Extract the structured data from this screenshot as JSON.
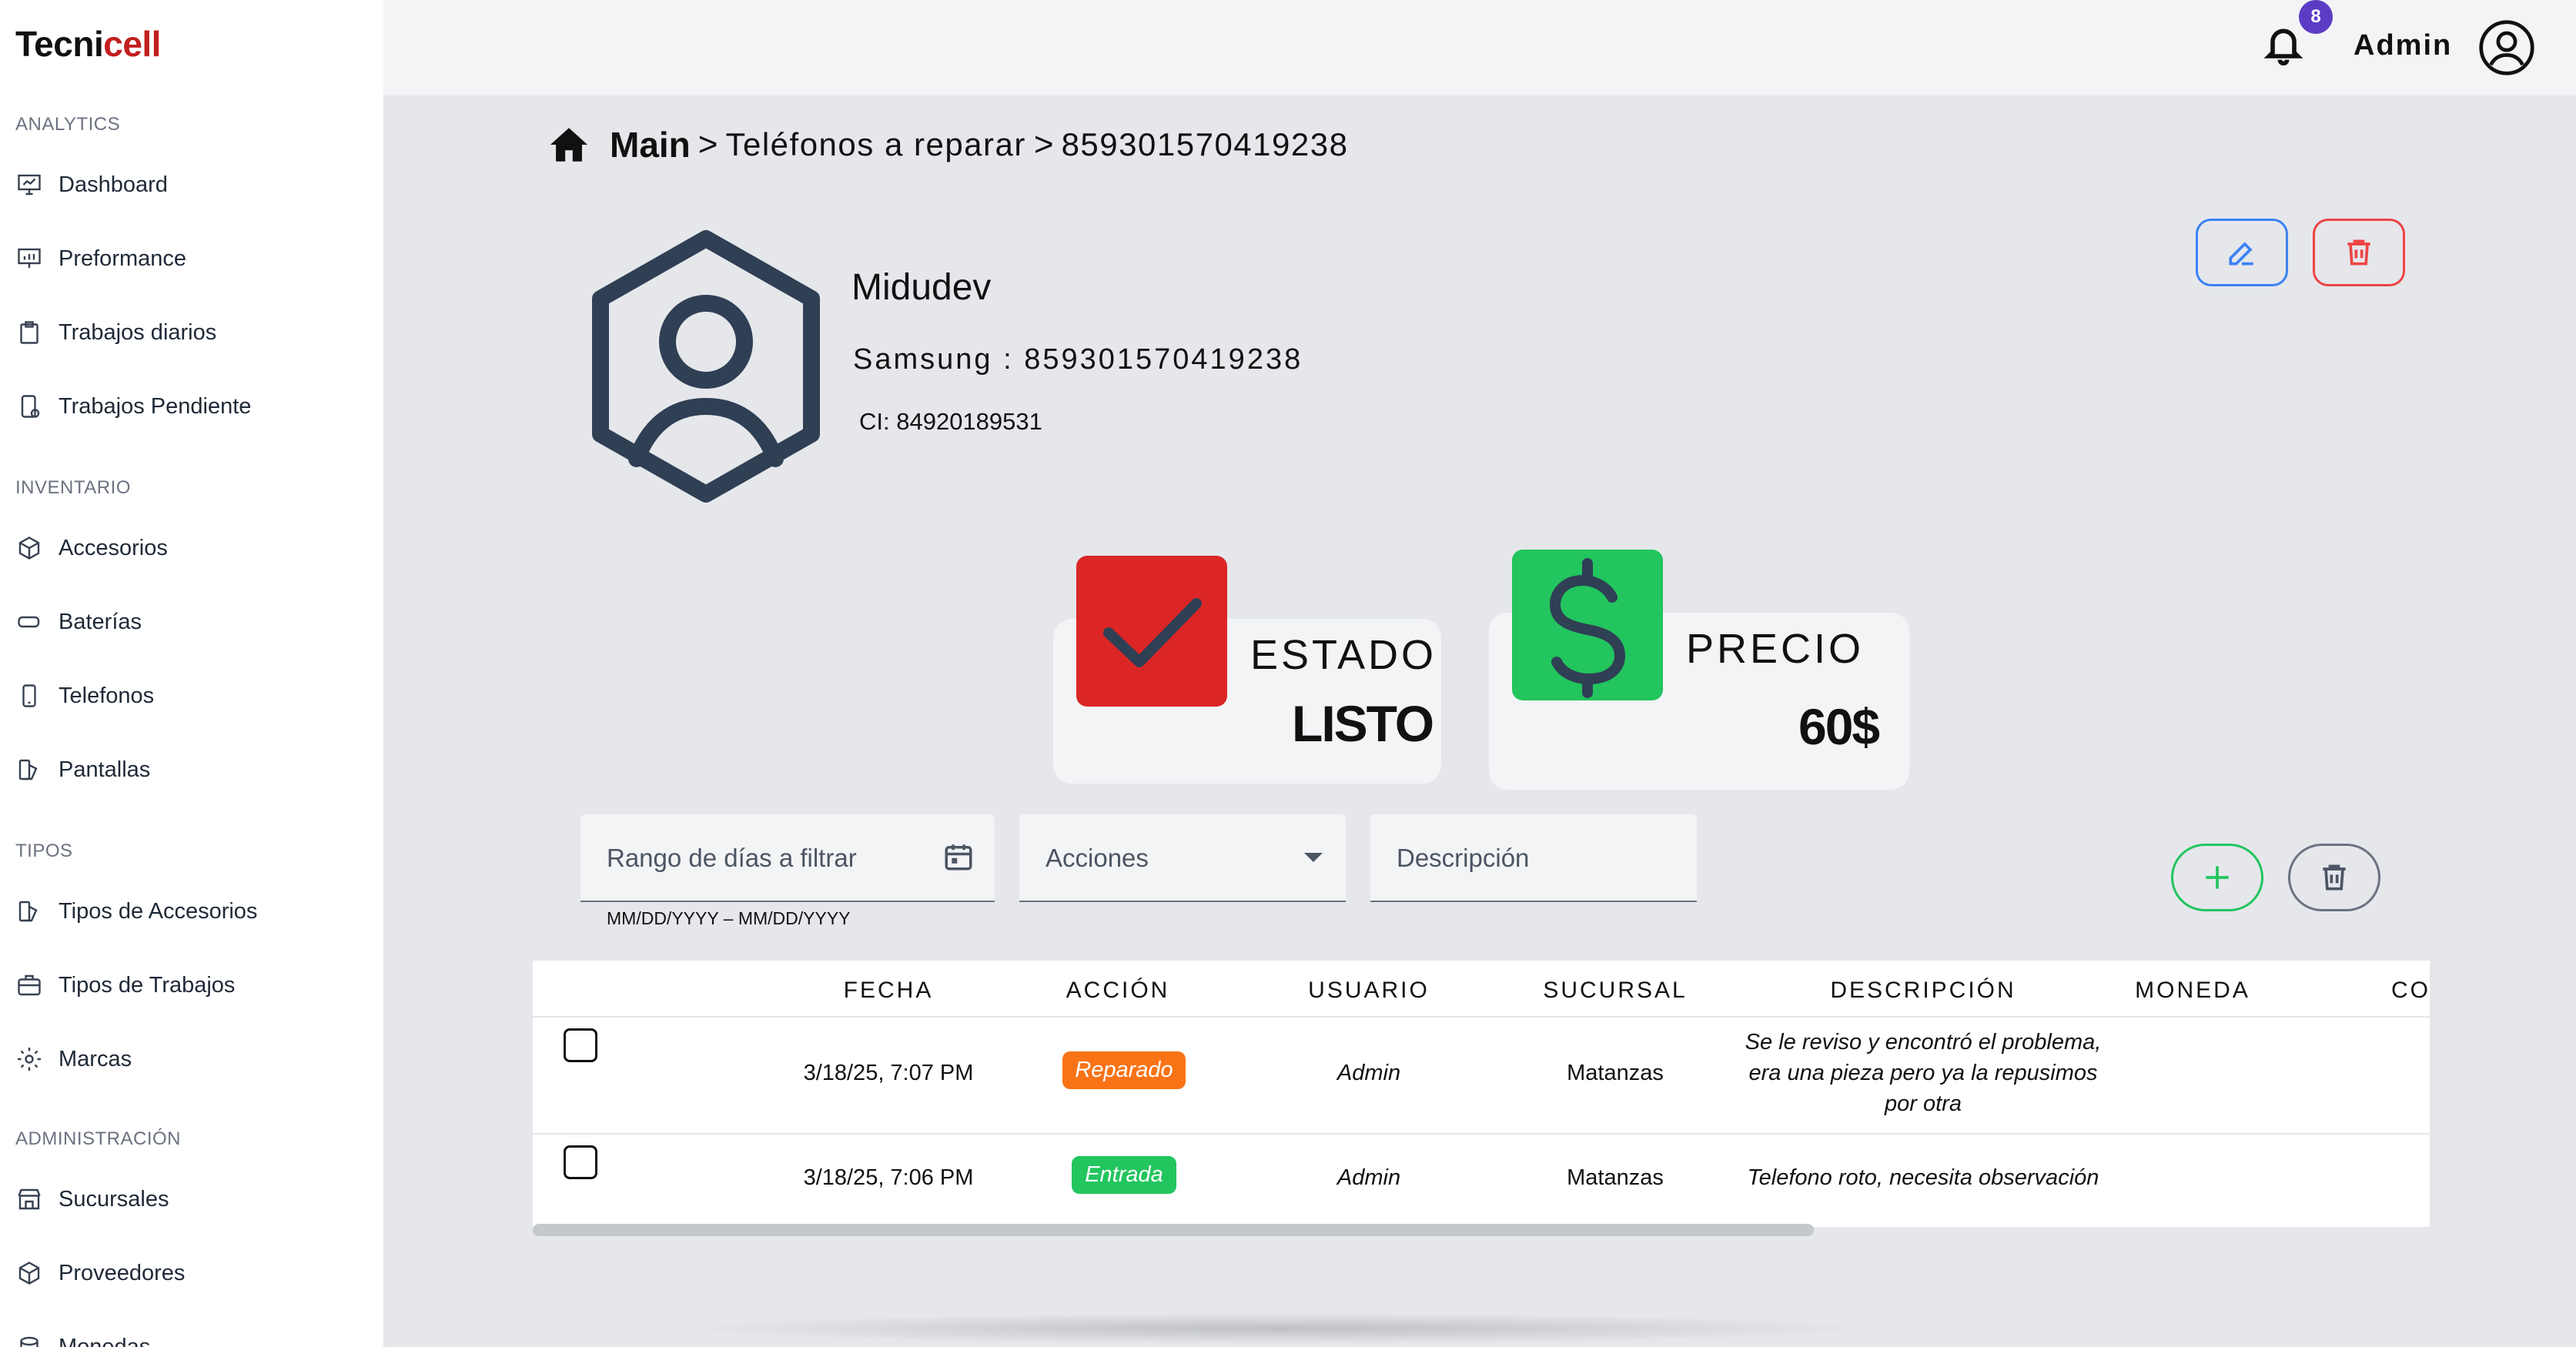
{
  "brand": {
    "part1": "Tecni",
    "part2": "cell"
  },
  "sidebar": {
    "sections": [
      {
        "title": "ANALYTICS",
        "items": [
          "Dashboard",
          "Preformance",
          "Trabajos diarios",
          "Trabajos Pendiente"
        ]
      },
      {
        "title": "INVENTARIO",
        "items": [
          "Accesorios",
          "Baterías",
          "Telefonos",
          "Pantallas"
        ]
      },
      {
        "title": "TIPOS",
        "items": [
          "Tipos de Accesorios",
          "Tipos de Trabajos",
          "Marcas"
        ]
      },
      {
        "title": "ADMINISTRACIÓN",
        "items": [
          "Sucursales",
          "Proveedores",
          "Monedas"
        ]
      }
    ]
  },
  "topbar": {
    "notifications_count": "8",
    "user_label": "Admin"
  },
  "breadcrumb": {
    "main": "Main",
    "sep1": ">",
    "item1": "Teléfonos a reparar",
    "sep2": ">",
    "item2": "859301570419238"
  },
  "client": {
    "name": "Midudev",
    "device": "Samsung : 859301570419238",
    "ci": "CI: 84920189531"
  },
  "estado_card": {
    "label": "ESTADO",
    "value": "LISTO"
  },
  "precio_card": {
    "label": "PRECIO",
    "value": "60$"
  },
  "filters": {
    "date_range": "Rango de días a filtrar",
    "date_helper": "MM/DD/YYYY – MM/DD/YYYY",
    "acciones": "Acciones",
    "descripcion": "Descripción"
  },
  "table": {
    "headers": [
      "FECHA",
      "ACCIÓN",
      "USUARIO",
      "SUCURSAL",
      "DESCRIPCIÓN",
      "MONEDA",
      "CO"
    ],
    "rows": [
      {
        "fecha": "3/18/25, 7:07 PM",
        "accion": "Reparado",
        "usuario": "Admin",
        "sucursal": "Matanzas",
        "descripcion_l1": "Se le reviso y encontró el problema,",
        "descripcion_l2": "era una pieza pero ya la repusimos",
        "descripcion_l3": "por otra"
      },
      {
        "fecha": "3/18/25, 7:06 PM",
        "accion": "Entrada",
        "usuario": "Admin",
        "sucursal": "Matanzas",
        "descripcion_l1": "Telefono roto, necesita observación"
      }
    ]
  },
  "colors": {
    "accent_red": "#c21f1f",
    "estado_red": "#dc2626",
    "precio_green": "#22c55e",
    "badge_orange": "#f97316",
    "notif_purple": "#5b3cc4"
  }
}
